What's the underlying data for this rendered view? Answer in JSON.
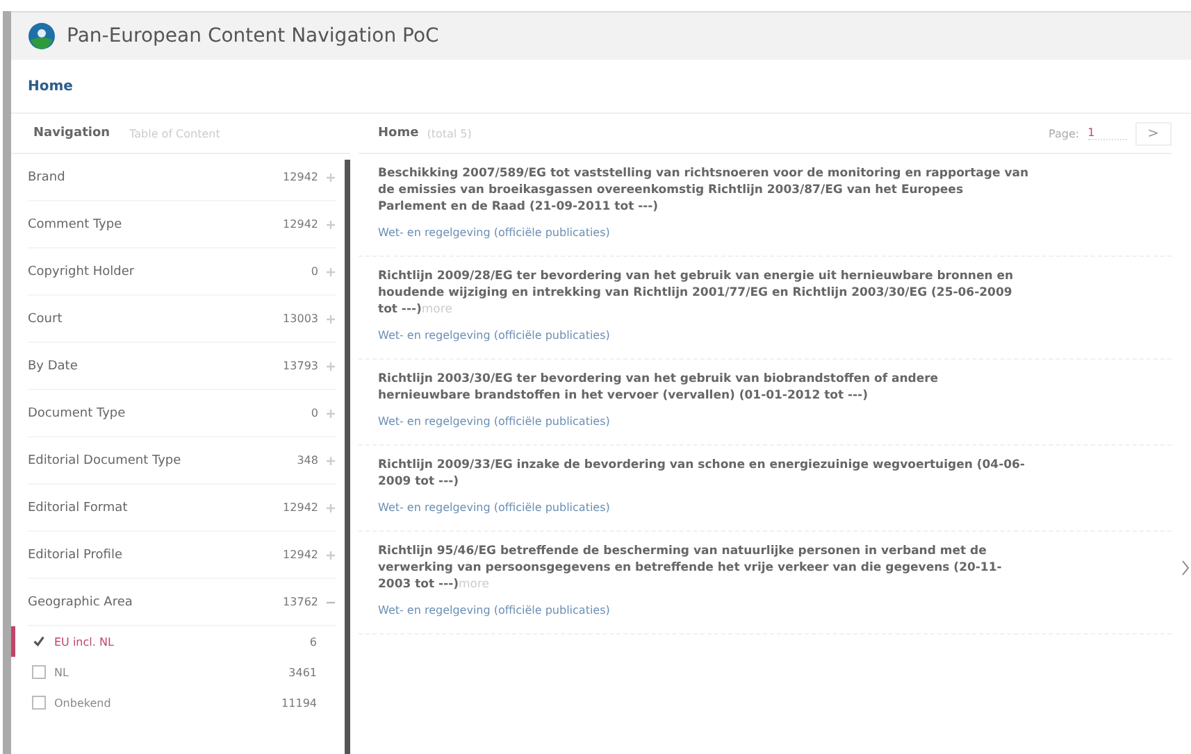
{
  "app": {
    "title": "Pan-European Content Navigation PoC"
  },
  "breadcrumb": "Home",
  "navigation": {
    "title": "Navigation",
    "tab": "Table of Content",
    "facets": [
      {
        "label": "Brand",
        "count": "12942",
        "expanded": false
      },
      {
        "label": "Comment Type",
        "count": "12942",
        "expanded": false
      },
      {
        "label": "Copyright Holder",
        "count": "0",
        "expanded": false
      },
      {
        "label": "Court",
        "count": "13003",
        "expanded": false
      },
      {
        "label": "By Date",
        "count": "13793",
        "expanded": false
      },
      {
        "label": "Document Type",
        "count": "0",
        "expanded": false
      },
      {
        "label": "Editorial Document Type",
        "count": "348",
        "expanded": false
      },
      {
        "label": "Editorial Format",
        "count": "12942",
        "expanded": false
      },
      {
        "label": "Editorial Profile",
        "count": "12942",
        "expanded": false
      },
      {
        "label": "Geographic Area",
        "count": "13762",
        "expanded": true,
        "children": [
          {
            "label": "EU incl. NL",
            "count": "6",
            "checked": true
          },
          {
            "label": "NL",
            "count": "3461",
            "checked": false
          },
          {
            "label": "Onbekend",
            "count": "11194",
            "checked": false
          }
        ]
      }
    ]
  },
  "results": {
    "title": "Home",
    "subtitle": "(total 5)",
    "page_label": "Page:",
    "page": "1",
    "next": ">",
    "items": [
      {
        "title": "Beschikking 2007/589/EG tot vaststelling van richtsnoeren voor de monitoring en rapportage van de emissies van broeikasgassen overeenkomstig Richtlijn 2003/87/EG van het Europees Parlement en de Raad (21-09-2011 tot ---)",
        "source": "Wet- en regelgeving (officiële publicaties)"
      },
      {
        "title": "Richtlijn 2009/28/EG ter bevordering van het gebruik van energie uit hernieuwbare bronnen en houdende wijziging en intrekking van Richtlijn 2001/77/EG en Richtlijn 2003/30/EG (25-06-2009 tot ---)",
        "more": "more",
        "source": "Wet- en regelgeving (officiële publicaties)"
      },
      {
        "title": "Richtlijn 2003/30/EG ter bevordering van het gebruik van biobrandstoffen of andere hernieuwbare brandstoffen in het vervoer (vervallen) (01-01-2012 tot ---)",
        "source": "Wet- en regelgeving (officiële publicaties)"
      },
      {
        "title": "Richtlijn 2009/33/EG inzake de bevordering van schone en energiezuinige wegvoertuigen (04-06-2009 tot ---)",
        "source": "Wet- en regelgeving (officiële publicaties)"
      },
      {
        "title": "Richtlijn 95/46/EG betreffende de bescherming van natuurlijke personen in verband met de verwerking van persoonsgegevens en betreffende het vrije verkeer van die gegevens (20-11-2003 tot ---)",
        "more": "more",
        "source": "Wet- en regelgeving (officiële publicaties)"
      }
    ]
  }
}
